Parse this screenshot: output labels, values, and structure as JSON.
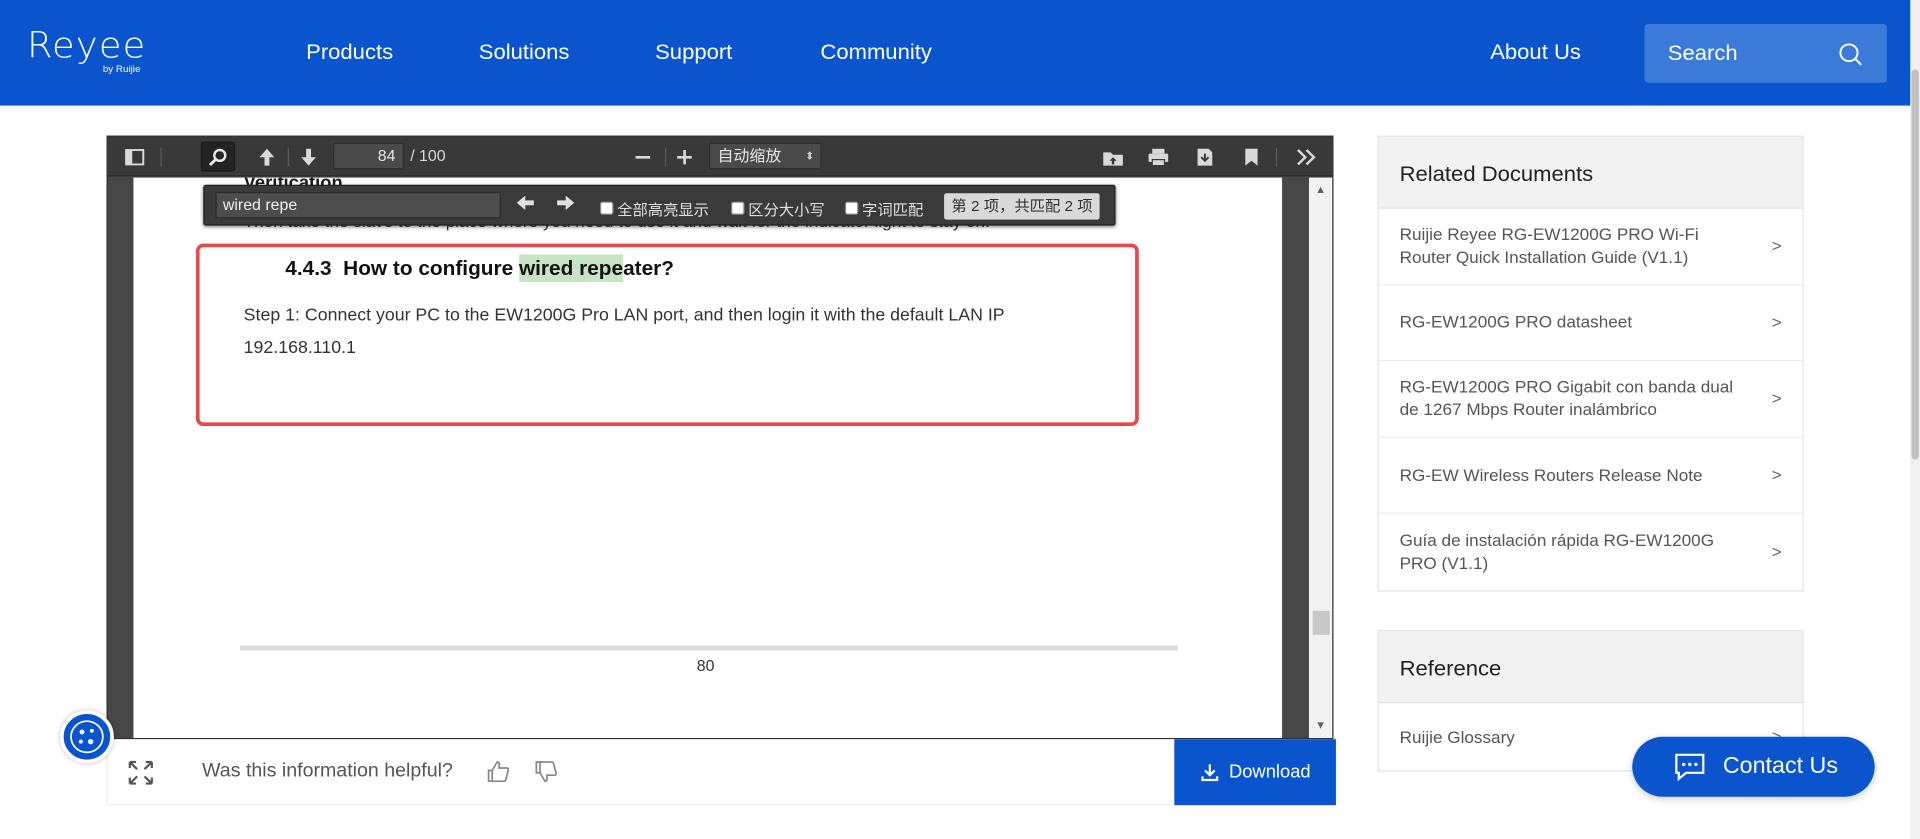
{
  "brand": {
    "logo_text": "Reyee",
    "logo_sub": "by Ruijie",
    "color": "#0a55cd"
  },
  "nav": {
    "items": [
      {
        "label": "Products"
      },
      {
        "label": "Solutions"
      },
      {
        "label": "Support"
      },
      {
        "label": "Community"
      }
    ],
    "about": "About Us",
    "search_label": "Search"
  },
  "pdf_toolbar": {
    "current_page": "84",
    "total_pages": "/ 100",
    "zoom": "自动缩放"
  },
  "find_bar": {
    "query": "wired repe",
    "highlight_all": "全部高亮显示",
    "match_case": "区分大小写",
    "whole_words": "字词匹配",
    "result_count": "第 2 项，共匹配 2 项"
  },
  "document": {
    "cut_heading": "Verification",
    "cut_line": "Then take the slave to the place where you need to use it and wait for the indicator light to stay on.",
    "section_number": "4.4.3",
    "heading_pre": "How to configure ",
    "heading_match": "wired repe",
    "heading_post": "ater?",
    "step_text": "Step 1: Connect your PC to the EW1200G Pro LAN port, and then login it with the default LAN IP",
    "ip_text": "192.168.110.1",
    "page_number": "80"
  },
  "feedback": {
    "question": "Was this information helpful?",
    "download_label": "Download"
  },
  "related": {
    "title": "Related Documents",
    "items": [
      {
        "label": "Ruijie Reyee RG-EW1200G PRO Wi-Fi Router Quick Installation Guide (V1.1)"
      },
      {
        "label": "RG-EW1200G PRO datasheet"
      },
      {
        "label": "RG-EW1200G PRO Gigabit con banda dual de 1267 Mbps Router inalámbrico"
      },
      {
        "label": "RG-EW Wireless Routers Release Note"
      },
      {
        "label": "Guía de instalación rápida RG-EW1200G PRO (V1.1)"
      }
    ],
    "chevron": ">"
  },
  "reference": {
    "title": "Reference",
    "items": [
      {
        "label": "Ruijie Glossary"
      }
    ],
    "chevron": ">"
  },
  "contact": {
    "label": "Contact Us"
  }
}
